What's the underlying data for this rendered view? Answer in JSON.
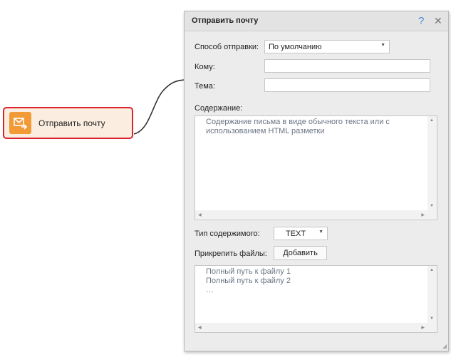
{
  "node": {
    "label": "Отправить почту",
    "icon": "mail-send-icon",
    "border_color": "#d9232d",
    "icon_color": "#f29a35"
  },
  "dialog": {
    "title": "Отправить почту",
    "help": "?",
    "close": "✕",
    "method_label": "Способ отправки:",
    "method_value": "По умолчанию",
    "to_label": "Кому:",
    "to_value": "",
    "subject_label": "Тема:",
    "subject_value": "",
    "content_label": "Содержание:",
    "content_placeholder": "Содержание письма в виде обычного текста или с использованием HTML разметки",
    "content_type_label": "Тип содержимого:",
    "content_type_value": "TEXT",
    "attach_label": "Прикрепить файлы:",
    "add_button": "Добавить",
    "files": [
      "Полный путь к файлу 1",
      "Полный путь к файлу 2",
      "…"
    ]
  }
}
